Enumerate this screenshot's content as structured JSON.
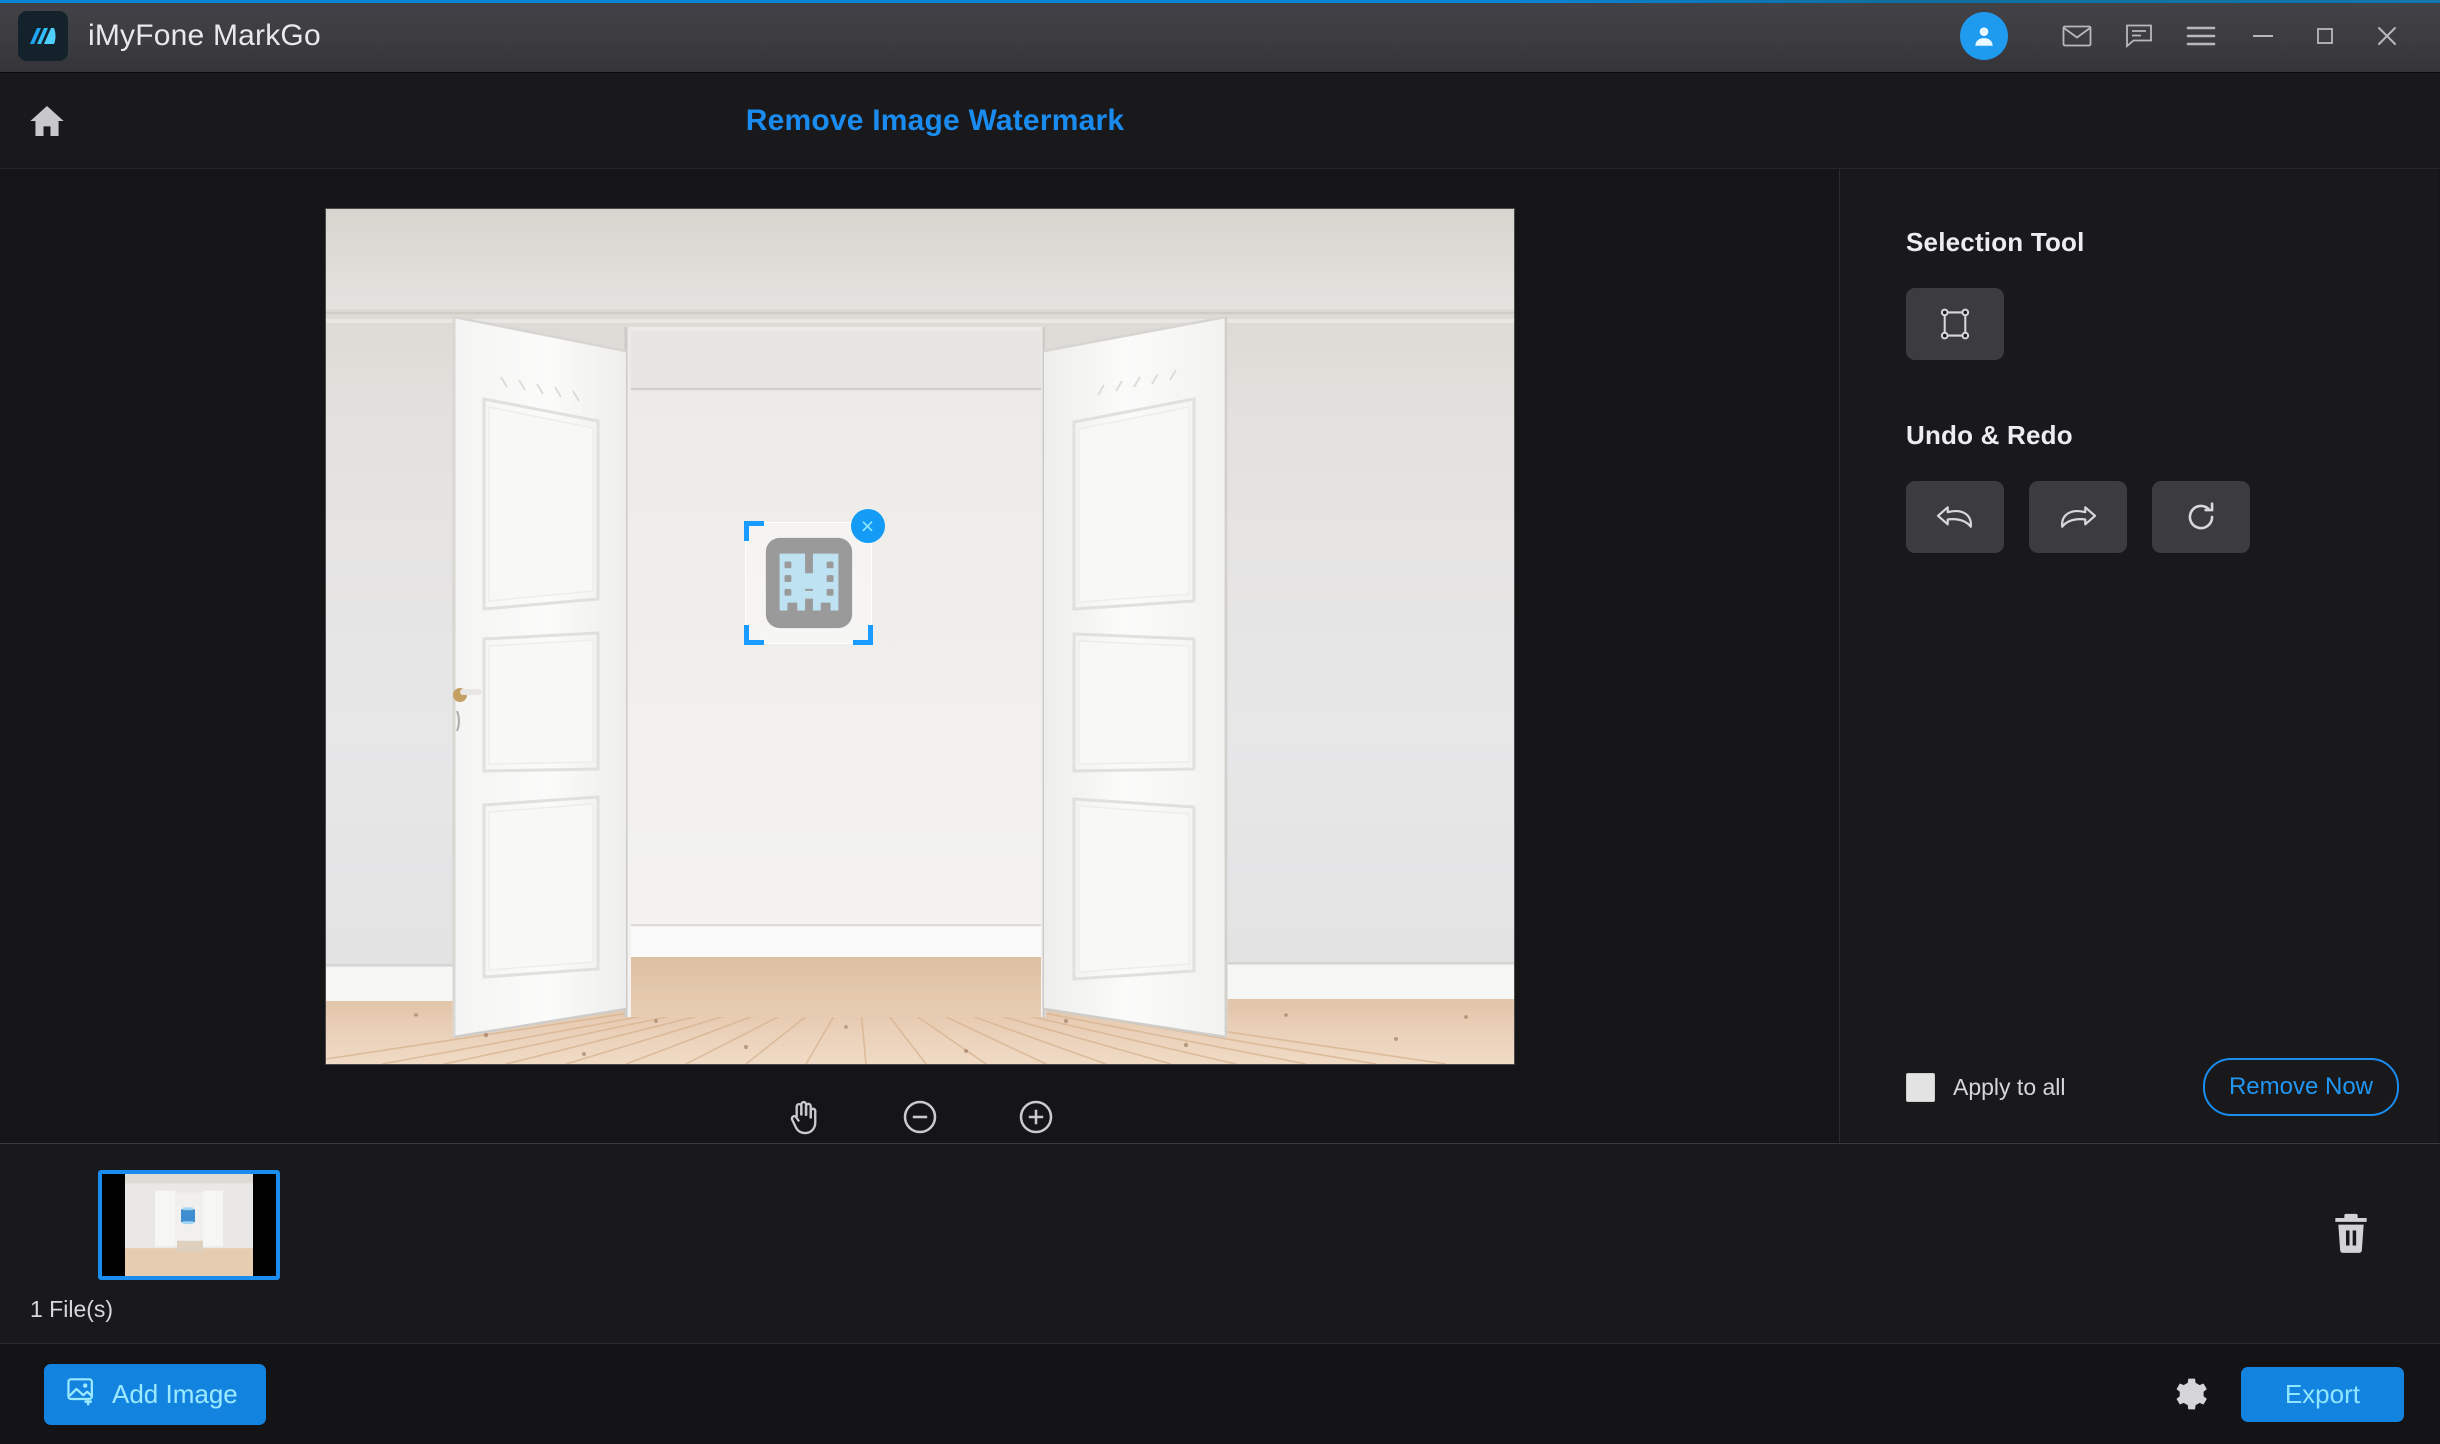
{
  "window": {
    "app_name": "iMyFone MarkGo",
    "logo_icon": "markgo-logo-icon",
    "accent_color": "#0a84d6",
    "controls": [
      {
        "name": "account-avatar",
        "icon": "user-icon"
      },
      {
        "name": "mail-button",
        "icon": "envelope-icon"
      },
      {
        "name": "feedback-button",
        "icon": "chat-bubble-icon"
      },
      {
        "name": "menu-button",
        "icon": "hamburger-menu-icon"
      },
      {
        "name": "minimize-button",
        "icon": "minimize-icon"
      },
      {
        "name": "maximize-button",
        "icon": "maximize-icon"
      },
      {
        "name": "close-button",
        "icon": "close-icon"
      }
    ]
  },
  "header": {
    "home_icon": "home-icon",
    "title": "Remove Image Watermark",
    "title_color": "#1a8cf0"
  },
  "canvas": {
    "photo_alt": "Empty white room with open double doors and wood parquet floor",
    "watermark": {
      "label": "selected-watermark-region",
      "close_label": "×",
      "glyph_icon": "video-film-watermark-icon"
    },
    "zoom_tools": [
      {
        "name": "pan-hand-tool",
        "icon": "hand-icon"
      },
      {
        "name": "zoom-out-button",
        "icon": "circle-minus-icon"
      },
      {
        "name": "zoom-in-button",
        "icon": "circle-plus-icon"
      }
    ]
  },
  "sidebar": {
    "selection_heading": "Selection Tool",
    "selection_tool": {
      "name": "rectangle-select-tool",
      "icon": "rectangle-select-icon"
    },
    "undo_heading": "Undo & Redo",
    "history_buttons": [
      {
        "name": "undo-button",
        "icon": "undo-arrow-icon"
      },
      {
        "name": "redo-button",
        "icon": "redo-arrow-icon"
      },
      {
        "name": "reset-button",
        "icon": "refresh-circle-icon"
      }
    ],
    "apply_to_all_label": "Apply to all",
    "apply_to_all_checked": false,
    "remove_now_label": "Remove Now",
    "remove_now_color": "#1a8cf0"
  },
  "thumbnails": {
    "file_count_label": "1 File(s)",
    "items": [
      {
        "name": "thumbnail-item-1",
        "selected": true
      }
    ],
    "delete_icon": "trash-icon"
  },
  "bottom_bar": {
    "add_image_label": "Add Image",
    "add_image_icon": "image-plus-icon",
    "settings_icon": "gear-icon",
    "export_label": "Export",
    "button_color": "#1383e0"
  }
}
